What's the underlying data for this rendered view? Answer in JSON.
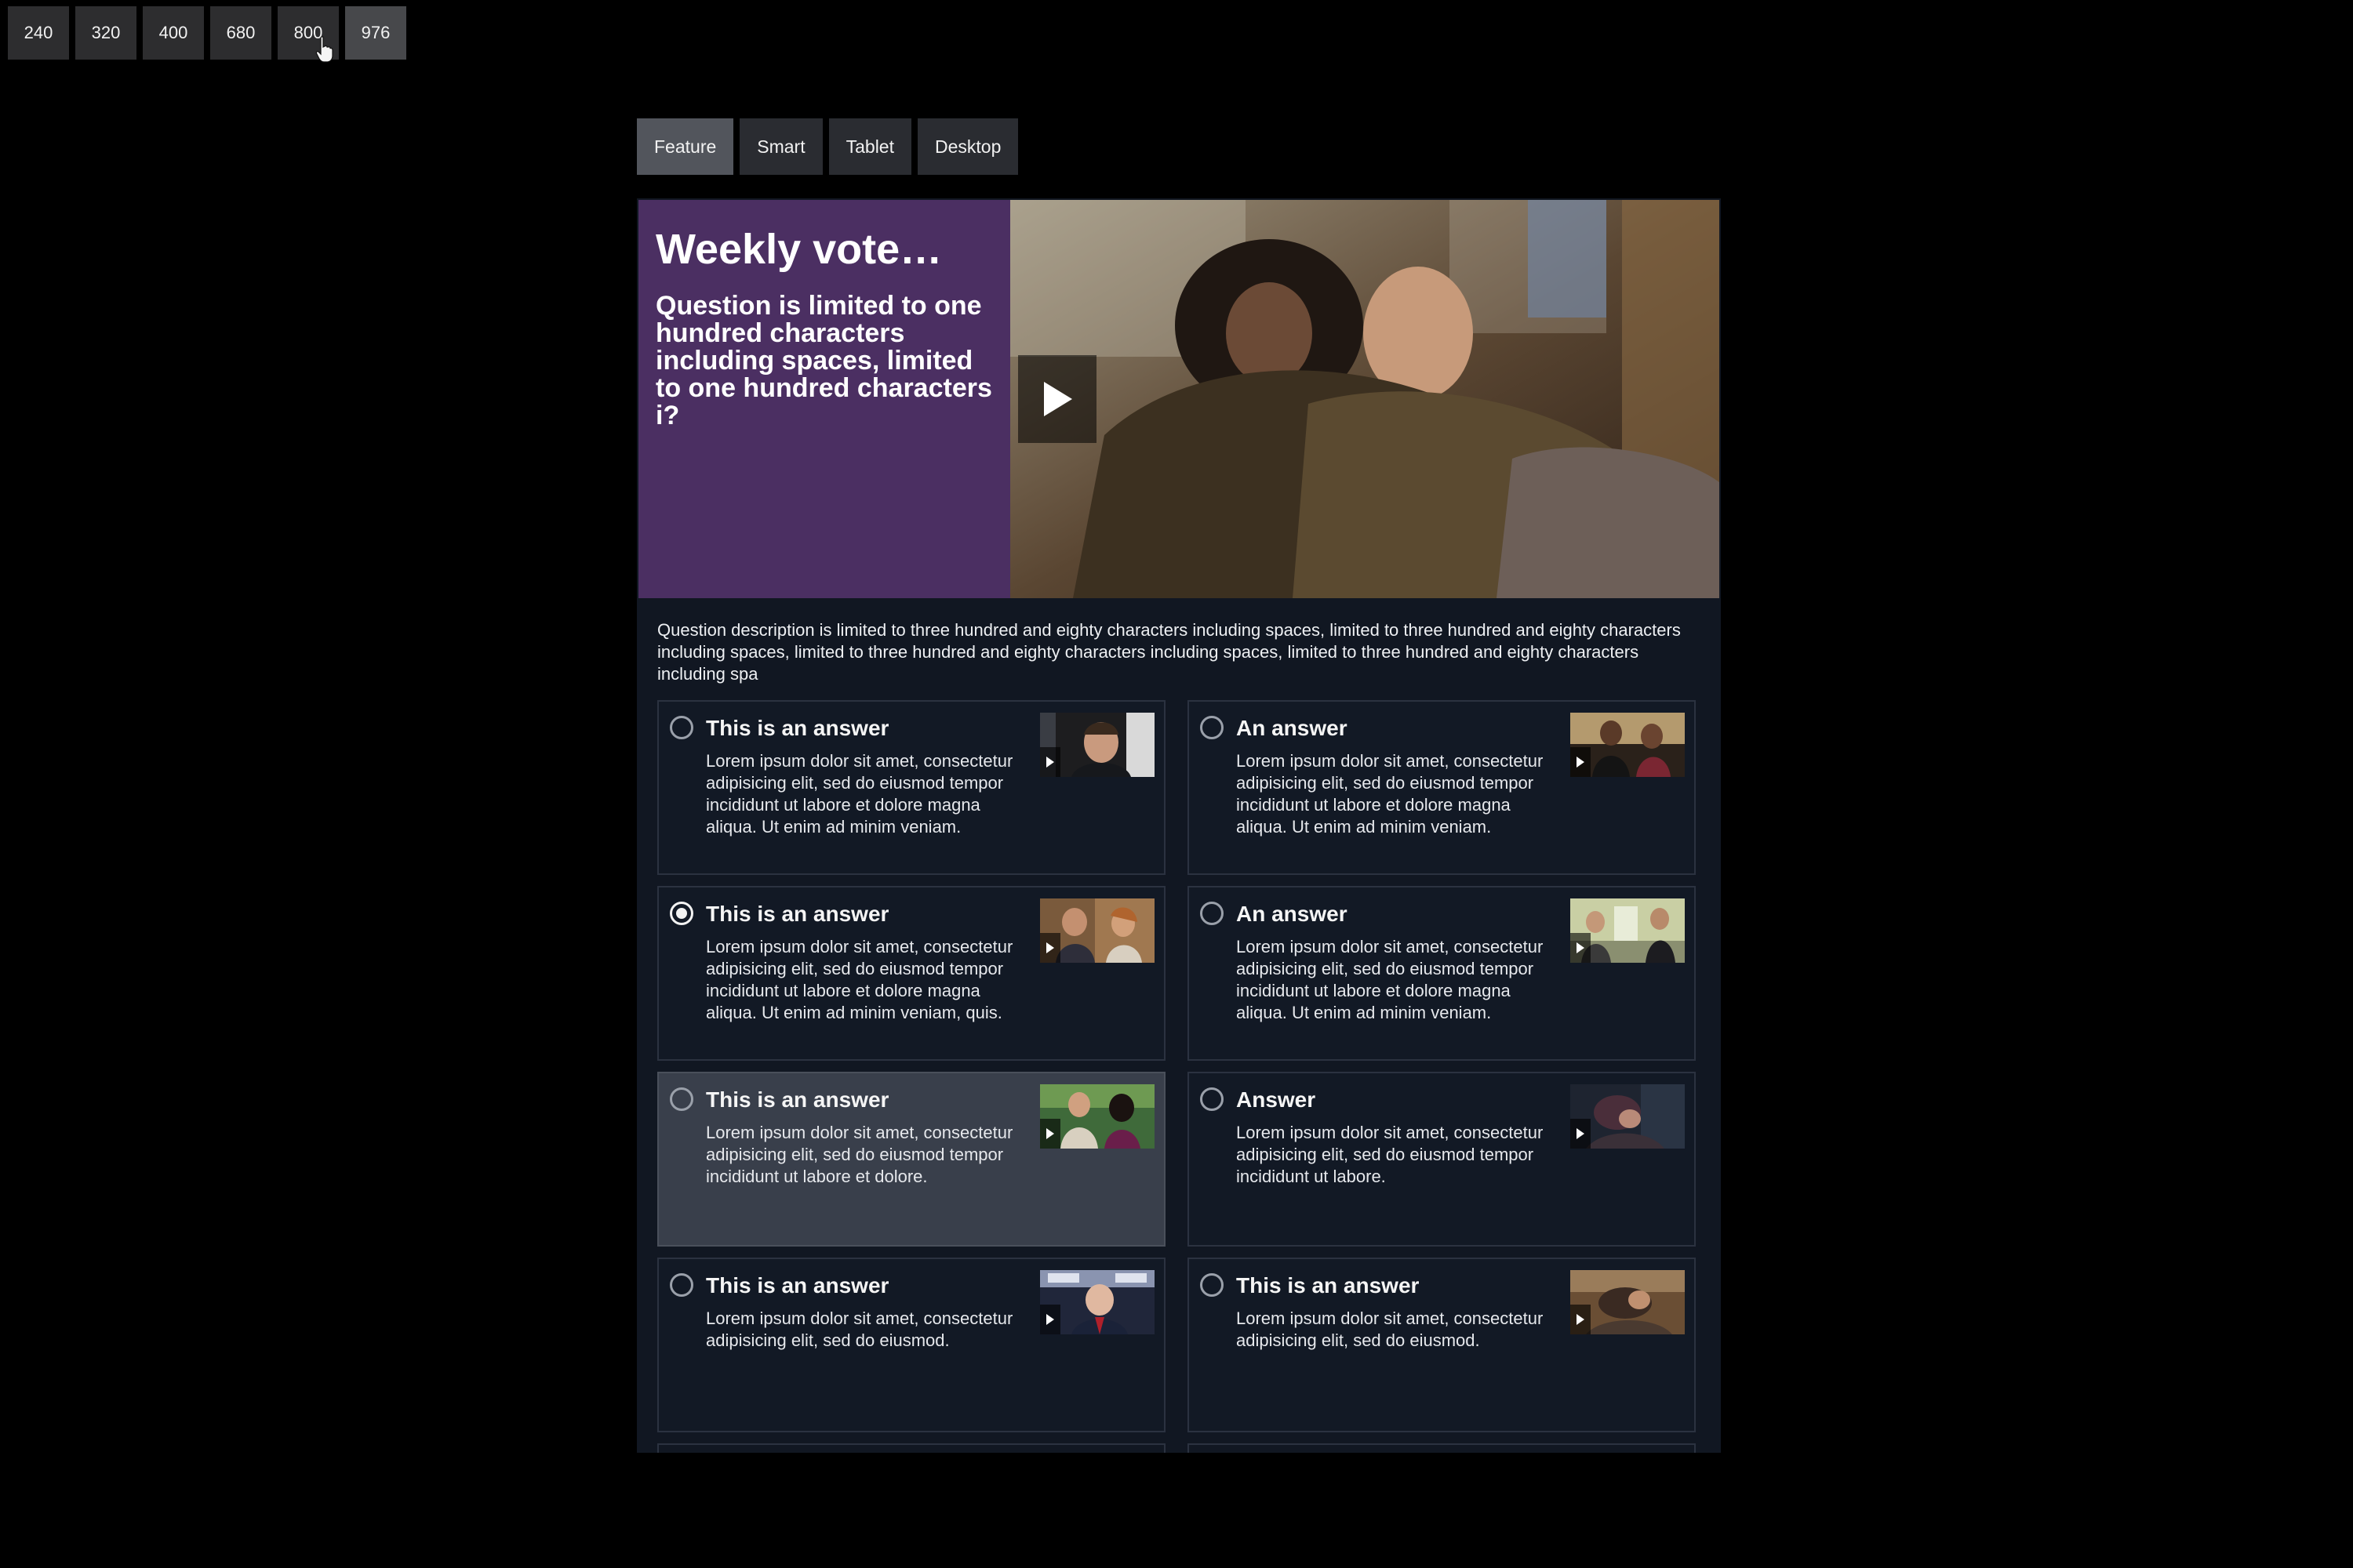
{
  "width_buttons": [
    {
      "label": "240"
    },
    {
      "label": "320"
    },
    {
      "label": "400"
    },
    {
      "label": "680"
    },
    {
      "label": "800"
    },
    {
      "label": "976",
      "active": true
    }
  ],
  "device_tabs": [
    {
      "label": "Feature",
      "active": true
    },
    {
      "label": "Smart"
    },
    {
      "label": "Tablet"
    },
    {
      "label": "Desktop"
    }
  ],
  "vote": {
    "title": "Weekly vote…",
    "question": "Question is limited to one hundred characters including spaces, limited to one hundred characters i?",
    "description": "Question description is limited to three hundred and eighty characters including spaces, limited to three hundred and eighty characters including spaces, limited to three hundred and eighty characters including spaces, limited to three hundred and eighty characters including spa",
    "hero_icon": "play-icon",
    "answers": [
      {
        "title": "This is an answer",
        "text": "Lorem ipsum dolor sit amet, consectetur adipisicing elit, sed do eiusmod tempor incididunt ut labore et dolore magna aliqua. Ut enim ad minim veniam.",
        "selected": false
      },
      {
        "title": "An answer",
        "text": "Lorem ipsum dolor sit amet, consectetur adipisicing elit, sed do eiusmod tempor incididunt ut labore et dolore magna aliqua. Ut enim ad minim veniam.",
        "selected": false
      },
      {
        "title": "This is an answer",
        "text": "Lorem ipsum dolor sit amet, consectetur adipisicing elit, sed do eiusmod tempor incididunt ut labore et dolore magna aliqua. Ut enim ad minim veniam, quis.",
        "selected": true
      },
      {
        "title": "An answer",
        "text": "Lorem ipsum dolor sit amet, consectetur adipisicing elit, sed do eiusmod tempor incididunt ut labore et dolore magna aliqua. Ut enim ad minim veniam.",
        "selected": false
      },
      {
        "title": "This is an answer",
        "text": "Lorem ipsum dolor sit amet, consectetur adipisicing elit, sed do eiusmod tempor incididunt ut labore et dolore.",
        "selected": false,
        "hovered": true
      },
      {
        "title": "Answer",
        "text": "Lorem ipsum dolor sit amet, consectetur adipisicing elit, sed do eiusmod tempor incididunt ut labore.",
        "selected": false
      },
      {
        "title": "This is an answer",
        "text": "Lorem ipsum dolor sit amet, consectetur adipisicing elit, sed do eiusmod.",
        "selected": false
      },
      {
        "title": "This is an answer",
        "text": "Lorem ipsum dolor sit amet, consectetur adipisicing elit, sed do eiusmod.",
        "selected": false
      }
    ]
  },
  "colors": {
    "background": "#000000",
    "hero_panel": "#4b2f62",
    "module_bg": "#111722",
    "card_border": "#2b3240",
    "card_hover": "#393f4b"
  }
}
